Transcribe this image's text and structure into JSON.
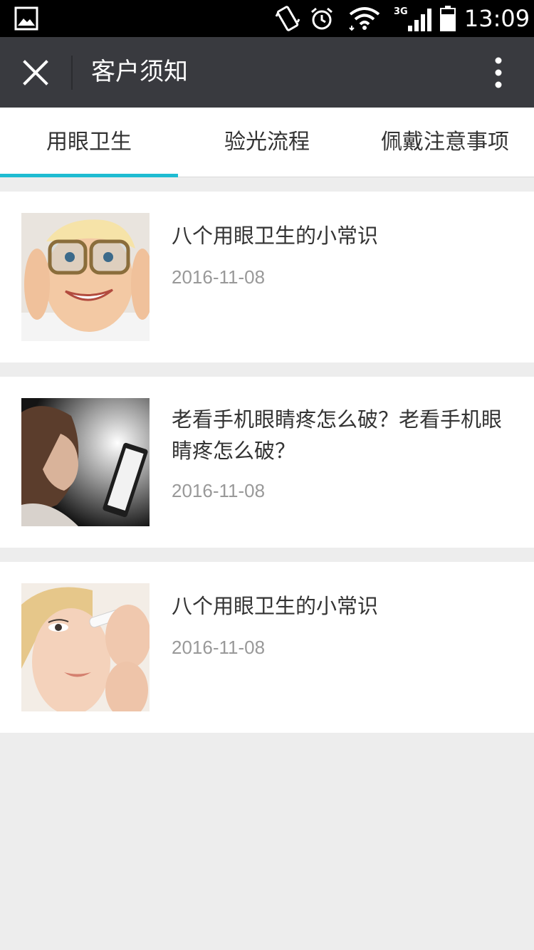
{
  "status_bar": {
    "time": "13:09",
    "network": "3G",
    "icons": [
      "image-icon",
      "vibrate-icon",
      "alarm-icon",
      "wifi-icon",
      "signal-icon",
      "battery-icon"
    ]
  },
  "title_bar": {
    "title": "客户须知",
    "close_icon": "close-icon",
    "more_icon": "more-vertical-icon",
    "background": "#393a3f"
  },
  "tabs": [
    {
      "label": "用眼卫生",
      "active": true
    },
    {
      "label": "验光流程",
      "active": false
    },
    {
      "label": "佩戴注意事项",
      "active": false
    }
  ],
  "accent_color": "#1fbcd2",
  "articles": [
    {
      "title": "八个用眼卫生的小常识",
      "date": "2016-11-08",
      "thumbnail": "child-with-glasses"
    },
    {
      "title": "老看手机眼睛疼怎么破？老看手机眼睛疼怎么破？",
      "date": "2016-11-08",
      "thumbnail": "child-looking-at-tablet"
    },
    {
      "title": "八个用眼卫生的小常识",
      "date": "2016-11-08",
      "thumbnail": "woman-using-eye-drops"
    }
  ]
}
